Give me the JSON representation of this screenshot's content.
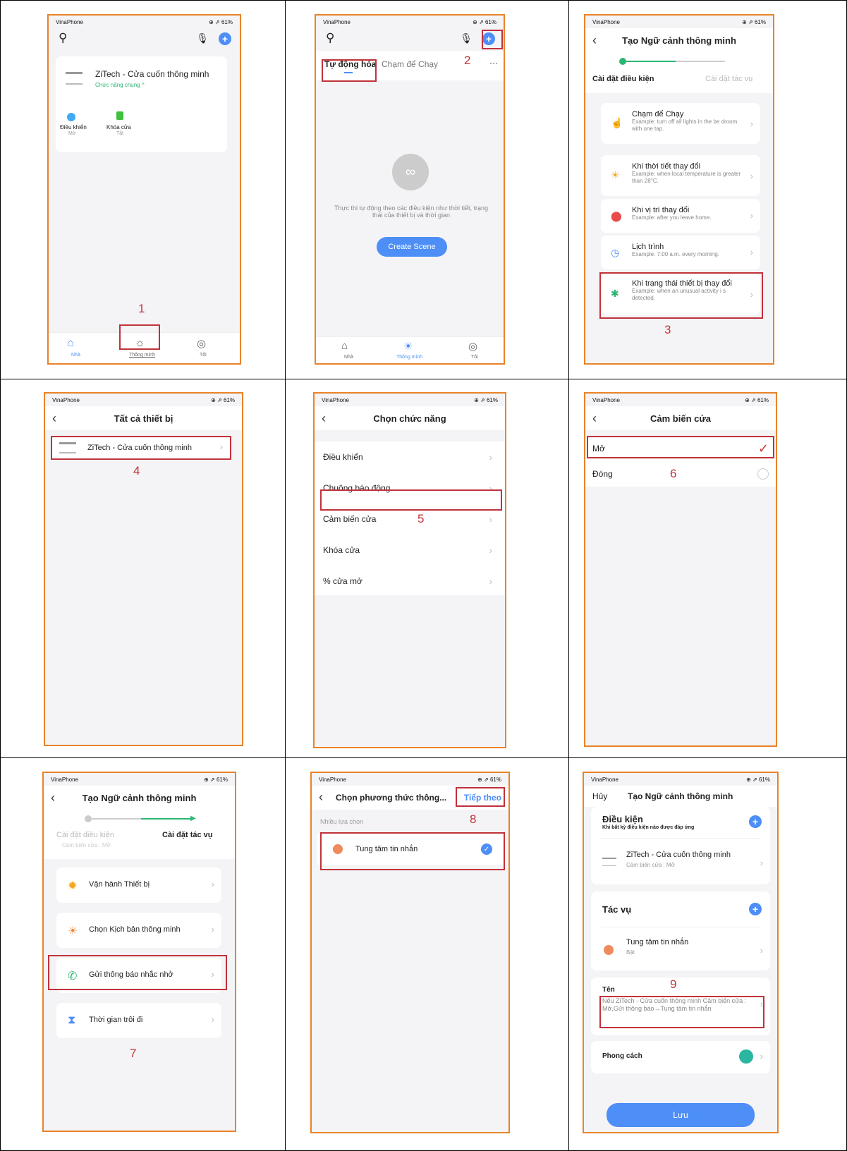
{
  "common": {
    "carrier": "VinaPhone",
    "status_right": "⊕ ⇗ 61%"
  },
  "p1": {
    "device": "ZiTech - Cửa cuốn thông minh",
    "sub": "Chức năng chung ^",
    "ctrl1": "Điều khiển",
    "ctrl1v": "Mở",
    "ctrl2": "Khóa cửa",
    "ctrl2v": "Tắt",
    "nav1": "Nhà",
    "nav2": "Thông minh",
    "nav3": "Tôi",
    "n": "1"
  },
  "p2": {
    "tab1": "Tự động hóa",
    "tab2": "Chạm để Chạy",
    "more": "···",
    "desc": "Thực thi tự động theo các điều kiện như thời tiết, trạng thái của thiết bị và thời gian",
    "btn": "Create Scene",
    "nav1": "Nhà",
    "nav2": "Thông minh",
    "nav3": "Tôi",
    "n": "2"
  },
  "p3": {
    "title": "Tạo Ngữ cảnh thông minh",
    "step1": "Cài đặt điều kiện",
    "step2": "Cài đặt tác vụ",
    "items": [
      {
        "t": "Chạm để Chạy",
        "e": "Example: turn off all lights in the be droom with one tap."
      },
      {
        "t": "Khi thời tiết thay đổi",
        "e": "Example: when local temperature is greater than 28°C."
      },
      {
        "t": "Khi vị trí thay đổi",
        "e": "Example: after you leave home."
      },
      {
        "t": "Lịch trình",
        "e": "Example: 7:00 a.m. every morning."
      },
      {
        "t": "Khi trạng thái thiết bị thay đổi",
        "e": "Example: when an unusual activity i s detected."
      }
    ],
    "n": "3"
  },
  "p4": {
    "title": "Tất cả thiết bị",
    "device": "ZiTech - Cửa cuốn thông minh",
    "n": "4"
  },
  "p5": {
    "title": "Chọn chức năng",
    "items": [
      "Điều khiển",
      "Chuông báo động",
      "Cảm biến cửa",
      "Khóa cửa",
      "% cửa mở"
    ],
    "n": "5"
  },
  "p6": {
    "title": "Cảm biến cửa",
    "o1": "Mở",
    "o2": "Đóng",
    "n": "6"
  },
  "p7": {
    "title": "Tạo Ngữ cảnh thông minh",
    "step1": "Cài đặt điều kiện",
    "step1sub": "Cảm biến cửa : Mở",
    "step2": "Cài đặt tác vụ",
    "items": [
      "Vận hành Thiết bị",
      "Chọn Kịch bản thông minh",
      "Gửi thông báo nhắc nhở",
      "Thời gian trôi đi"
    ],
    "n": "7"
  },
  "p8": {
    "title": "Chọn phương thức thông...",
    "next": "Tiếp theo",
    "sub": "Nhiều lựa chọn",
    "item": "Tung tâm tin nhắn",
    "n": "8"
  },
  "p9": {
    "cancel": "Hủy",
    "title": "Tạo Ngữ cảnh thông minh",
    "cond": "Điều kiện",
    "condsub": "Khi bất kỳ điều kiện nào được đáp ứng",
    "dev": "ZiTech - Cửa cuốn thông minh",
    "devsub": "Cảm biến cửa : Mở",
    "task": "Tác vụ",
    "taskitem": "Tung tâm tin nhắn",
    "taskitemsub": "Bật",
    "name": "Tên",
    "namev": "Nếu ZiTech - Cửa cuốn thông minh Cảm biến cửa : Mở,Gửi thông báo→Tung tâm tin nhắn",
    "style": "Phong cách",
    "save": "Lưu",
    "n": "9"
  }
}
